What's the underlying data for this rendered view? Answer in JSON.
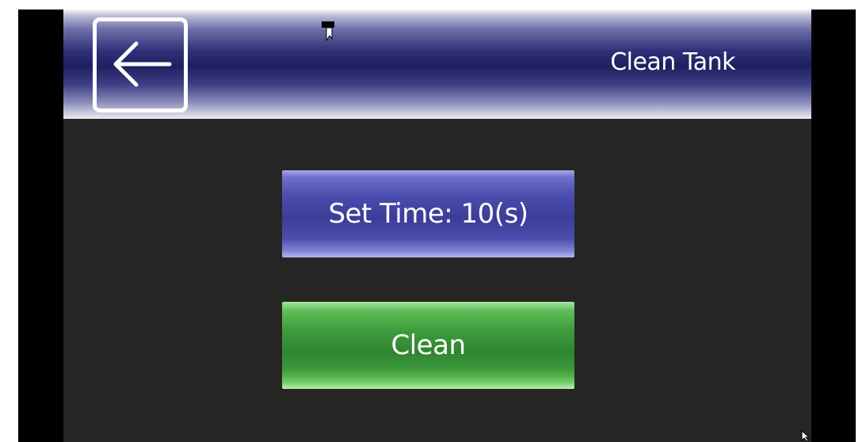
{
  "header": {
    "title": "Clean Tank",
    "back_icon": "arrow-left-icon"
  },
  "controls": {
    "set_time_label": "Set Time: 10(s)",
    "clean_label": "Clean"
  },
  "colors": {
    "header_navy": "#1f1f60",
    "screen_background": "#252523",
    "time_button_blue": "#3b3d98",
    "clean_button_green": "#2f8530",
    "text": "#ffffff"
  }
}
